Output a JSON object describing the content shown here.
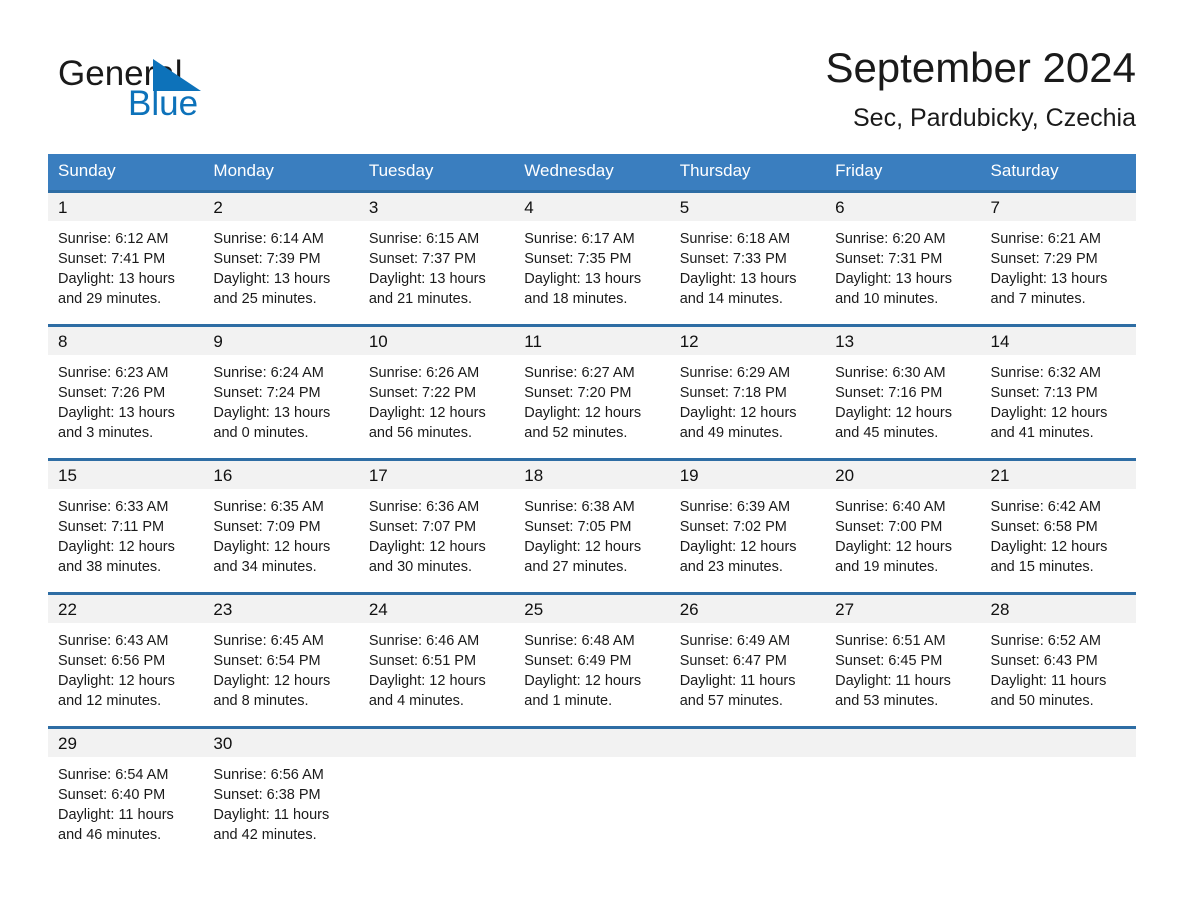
{
  "brand": {
    "name_part1": "General",
    "name_part2": "Blue",
    "accent_color": "#0d72ba"
  },
  "header": {
    "title": "September 2024",
    "subtitle": "Sec, Pardubicky, Czechia"
  },
  "calendar": {
    "header_color": "#3a7ebf",
    "row_divider_color": "#2e6da4",
    "daynum_band_color": "#f2f2f2",
    "weekdays": [
      "Sunday",
      "Monday",
      "Tuesday",
      "Wednesday",
      "Thursday",
      "Friday",
      "Saturday"
    ],
    "weeks": [
      [
        {
          "day": "1",
          "sunrise": "Sunrise: 6:12 AM",
          "sunset": "Sunset: 7:41 PM",
          "daylight_1": "Daylight: 13 hours",
          "daylight_2": "and 29 minutes."
        },
        {
          "day": "2",
          "sunrise": "Sunrise: 6:14 AM",
          "sunset": "Sunset: 7:39 PM",
          "daylight_1": "Daylight: 13 hours",
          "daylight_2": "and 25 minutes."
        },
        {
          "day": "3",
          "sunrise": "Sunrise: 6:15 AM",
          "sunset": "Sunset: 7:37 PM",
          "daylight_1": "Daylight: 13 hours",
          "daylight_2": "and 21 minutes."
        },
        {
          "day": "4",
          "sunrise": "Sunrise: 6:17 AM",
          "sunset": "Sunset: 7:35 PM",
          "daylight_1": "Daylight: 13 hours",
          "daylight_2": "and 18 minutes."
        },
        {
          "day": "5",
          "sunrise": "Sunrise: 6:18 AM",
          "sunset": "Sunset: 7:33 PM",
          "daylight_1": "Daylight: 13 hours",
          "daylight_2": "and 14 minutes."
        },
        {
          "day": "6",
          "sunrise": "Sunrise: 6:20 AM",
          "sunset": "Sunset: 7:31 PM",
          "daylight_1": "Daylight: 13 hours",
          "daylight_2": "and 10 minutes."
        },
        {
          "day": "7",
          "sunrise": "Sunrise: 6:21 AM",
          "sunset": "Sunset: 7:29 PM",
          "daylight_1": "Daylight: 13 hours",
          "daylight_2": "and 7 minutes."
        }
      ],
      [
        {
          "day": "8",
          "sunrise": "Sunrise: 6:23 AM",
          "sunset": "Sunset: 7:26 PM",
          "daylight_1": "Daylight: 13 hours",
          "daylight_2": "and 3 minutes."
        },
        {
          "day": "9",
          "sunrise": "Sunrise: 6:24 AM",
          "sunset": "Sunset: 7:24 PM",
          "daylight_1": "Daylight: 13 hours",
          "daylight_2": "and 0 minutes."
        },
        {
          "day": "10",
          "sunrise": "Sunrise: 6:26 AM",
          "sunset": "Sunset: 7:22 PM",
          "daylight_1": "Daylight: 12 hours",
          "daylight_2": "and 56 minutes."
        },
        {
          "day": "11",
          "sunrise": "Sunrise: 6:27 AM",
          "sunset": "Sunset: 7:20 PM",
          "daylight_1": "Daylight: 12 hours",
          "daylight_2": "and 52 minutes."
        },
        {
          "day": "12",
          "sunrise": "Sunrise: 6:29 AM",
          "sunset": "Sunset: 7:18 PM",
          "daylight_1": "Daylight: 12 hours",
          "daylight_2": "and 49 minutes."
        },
        {
          "day": "13",
          "sunrise": "Sunrise: 6:30 AM",
          "sunset": "Sunset: 7:16 PM",
          "daylight_1": "Daylight: 12 hours",
          "daylight_2": "and 45 minutes."
        },
        {
          "day": "14",
          "sunrise": "Sunrise: 6:32 AM",
          "sunset": "Sunset: 7:13 PM",
          "daylight_1": "Daylight: 12 hours",
          "daylight_2": "and 41 minutes."
        }
      ],
      [
        {
          "day": "15",
          "sunrise": "Sunrise: 6:33 AM",
          "sunset": "Sunset: 7:11 PM",
          "daylight_1": "Daylight: 12 hours",
          "daylight_2": "and 38 minutes."
        },
        {
          "day": "16",
          "sunrise": "Sunrise: 6:35 AM",
          "sunset": "Sunset: 7:09 PM",
          "daylight_1": "Daylight: 12 hours",
          "daylight_2": "and 34 minutes."
        },
        {
          "day": "17",
          "sunrise": "Sunrise: 6:36 AM",
          "sunset": "Sunset: 7:07 PM",
          "daylight_1": "Daylight: 12 hours",
          "daylight_2": "and 30 minutes."
        },
        {
          "day": "18",
          "sunrise": "Sunrise: 6:38 AM",
          "sunset": "Sunset: 7:05 PM",
          "daylight_1": "Daylight: 12 hours",
          "daylight_2": "and 27 minutes."
        },
        {
          "day": "19",
          "sunrise": "Sunrise: 6:39 AM",
          "sunset": "Sunset: 7:02 PM",
          "daylight_1": "Daylight: 12 hours",
          "daylight_2": "and 23 minutes."
        },
        {
          "day": "20",
          "sunrise": "Sunrise: 6:40 AM",
          "sunset": "Sunset: 7:00 PM",
          "daylight_1": "Daylight: 12 hours",
          "daylight_2": "and 19 minutes."
        },
        {
          "day": "21",
          "sunrise": "Sunrise: 6:42 AM",
          "sunset": "Sunset: 6:58 PM",
          "daylight_1": "Daylight: 12 hours",
          "daylight_2": "and 15 minutes."
        }
      ],
      [
        {
          "day": "22",
          "sunrise": "Sunrise: 6:43 AM",
          "sunset": "Sunset: 6:56 PM",
          "daylight_1": "Daylight: 12 hours",
          "daylight_2": "and 12 minutes."
        },
        {
          "day": "23",
          "sunrise": "Sunrise: 6:45 AM",
          "sunset": "Sunset: 6:54 PM",
          "daylight_1": "Daylight: 12 hours",
          "daylight_2": "and 8 minutes."
        },
        {
          "day": "24",
          "sunrise": "Sunrise: 6:46 AM",
          "sunset": "Sunset: 6:51 PM",
          "daylight_1": "Daylight: 12 hours",
          "daylight_2": "and 4 minutes."
        },
        {
          "day": "25",
          "sunrise": "Sunrise: 6:48 AM",
          "sunset": "Sunset: 6:49 PM",
          "daylight_1": "Daylight: 12 hours",
          "daylight_2": "and 1 minute."
        },
        {
          "day": "26",
          "sunrise": "Sunrise: 6:49 AM",
          "sunset": "Sunset: 6:47 PM",
          "daylight_1": "Daylight: 11 hours",
          "daylight_2": "and 57 minutes."
        },
        {
          "day": "27",
          "sunrise": "Sunrise: 6:51 AM",
          "sunset": "Sunset: 6:45 PM",
          "daylight_1": "Daylight: 11 hours",
          "daylight_2": "and 53 minutes."
        },
        {
          "day": "28",
          "sunrise": "Sunrise: 6:52 AM",
          "sunset": "Sunset: 6:43 PM",
          "daylight_1": "Daylight: 11 hours",
          "daylight_2": "and 50 minutes."
        }
      ],
      [
        {
          "day": "29",
          "sunrise": "Sunrise: 6:54 AM",
          "sunset": "Sunset: 6:40 PM",
          "daylight_1": "Daylight: 11 hours",
          "daylight_2": "and 46 minutes."
        },
        {
          "day": "30",
          "sunrise": "Sunrise: 6:56 AM",
          "sunset": "Sunset: 6:38 PM",
          "daylight_1": "Daylight: 11 hours",
          "daylight_2": "and 42 minutes."
        },
        {
          "day": "",
          "sunrise": "",
          "sunset": "",
          "daylight_1": "",
          "daylight_2": ""
        },
        {
          "day": "",
          "sunrise": "",
          "sunset": "",
          "daylight_1": "",
          "daylight_2": ""
        },
        {
          "day": "",
          "sunrise": "",
          "sunset": "",
          "daylight_1": "",
          "daylight_2": ""
        },
        {
          "day": "",
          "sunrise": "",
          "sunset": "",
          "daylight_1": "",
          "daylight_2": ""
        },
        {
          "day": "",
          "sunrise": "",
          "sunset": "",
          "daylight_1": "",
          "daylight_2": ""
        }
      ]
    ]
  }
}
